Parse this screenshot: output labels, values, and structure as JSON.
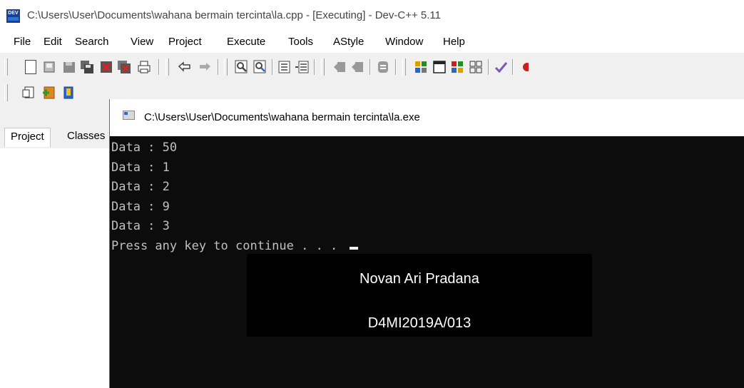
{
  "window": {
    "title": "C:\\Users\\User\\Documents\\wahana bermain tercinta\\la.cpp - [Executing] - Dev-C++ 5.11",
    "icon": "devcpp-app-icon"
  },
  "menu": [
    "File",
    "Edit",
    "Search",
    "View",
    "Project",
    "Execute",
    "Tools",
    "AStyle",
    "Window",
    "Help"
  ],
  "toolbar": {
    "row1_icons": [
      "new-file-icon",
      "open-icon",
      "save-icon",
      "save-all-icon",
      "close-icon",
      "close-all-icon",
      "print-icon",
      "undo-icon",
      "redo-icon",
      "find-icon",
      "replace-icon",
      "indent-icon",
      "unindent-icon",
      "bookmark-toggle-icon",
      "bookmark-goto-icon",
      "stop-icon",
      "compile-icon",
      "run-icon",
      "compile-run-icon",
      "rebuild-icon",
      "syntax-check-icon",
      "debug-icon"
    ],
    "row2_icons": [
      "insert-icon",
      "add-file-icon",
      "project-options-icon"
    ]
  },
  "left_panel": {
    "tabs": [
      "Project",
      "Classes"
    ]
  },
  "console": {
    "title": "C:\\Users\\User\\Documents\\wahana bermain tercinta\\la.exe",
    "lines": [
      "Data : 50",
      "Data : 1",
      "Data : 2",
      "Data : 9",
      "Data : 3",
      "Press any key to continue . . . "
    ]
  },
  "watermark": {
    "name": "Novan Ari Pradana",
    "id": "D4MI2019A/013"
  },
  "colors": {
    "console_bg": "#0c0c0c",
    "console_text": "#c0c0c0",
    "chrome_bg": "#f0f0f0"
  }
}
